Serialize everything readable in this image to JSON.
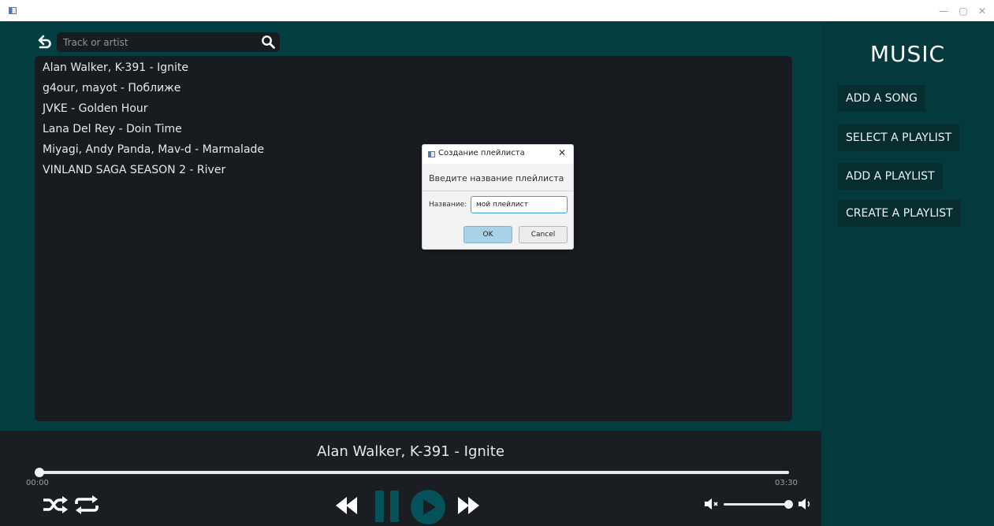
{
  "window": {
    "minimize_glyph": "—",
    "restore_glyph": "▢",
    "close_glyph": "✕"
  },
  "search": {
    "placeholder": "Track or artist",
    "value": ""
  },
  "track_list": {
    "items": [
      "Alan Walker, K-391 - Ignite",
      "g4our, mayot - Поближе",
      "JVKE - Golden Hour",
      "Lana Del Rey - Doin Time",
      "Miyagi, Andy Panda, Mav-d - Marmalade",
      "VINLAND SAGA SEASON 2 - River"
    ]
  },
  "sidebar": {
    "title": "MUSIC",
    "buttons": {
      "add_song": "ADD A SONG",
      "select_playlist": "SELECT A PLAYLIST",
      "add_playlist": "ADD A PLAYLIST",
      "create_playlist": "CREATE A PLAYLIST"
    }
  },
  "player": {
    "now_playing": "Alan Walker, K-391 - Ignite",
    "current_time": "00:00",
    "total_time": "03:30",
    "progress_fraction": 0,
    "volume_fraction": 0.95
  },
  "dialog": {
    "title": "Создание плейлиста",
    "close_glyph": "✕",
    "header": "Введите название плейлиста",
    "field_label": "Название:",
    "field_value": "мой плейлист",
    "ok_label": "OK",
    "cancel_label": "Cancel"
  },
  "colors": {
    "main_background": "#033e42",
    "sidebar_background": "#04393d",
    "panel_background": "#181c20",
    "player_background": "#1a1d21",
    "accent": "#06525a"
  }
}
